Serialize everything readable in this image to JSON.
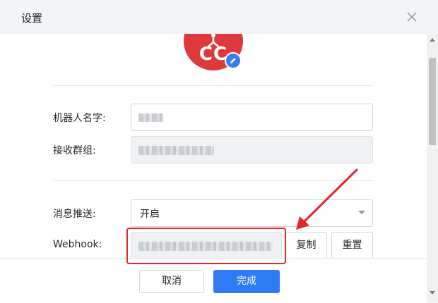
{
  "header": {
    "title": "设置"
  },
  "avatar": {
    "text": "CC",
    "color": "#dd3b3b"
  },
  "form": {
    "robot_name_label": "机器人名字:",
    "receive_group_label": "接收群组:",
    "push_label": "消息推送:",
    "push_value": "开启",
    "webhook_label": "Webhook:",
    "copy_button": "复制",
    "reset_button": "重置"
  },
  "footer": {
    "cancel_button": "取消",
    "done_button": "完成"
  },
  "colors": {
    "primary": "#2f7bf5",
    "annotation": "#e4262b",
    "avatar": "#dd3b3b"
  }
}
